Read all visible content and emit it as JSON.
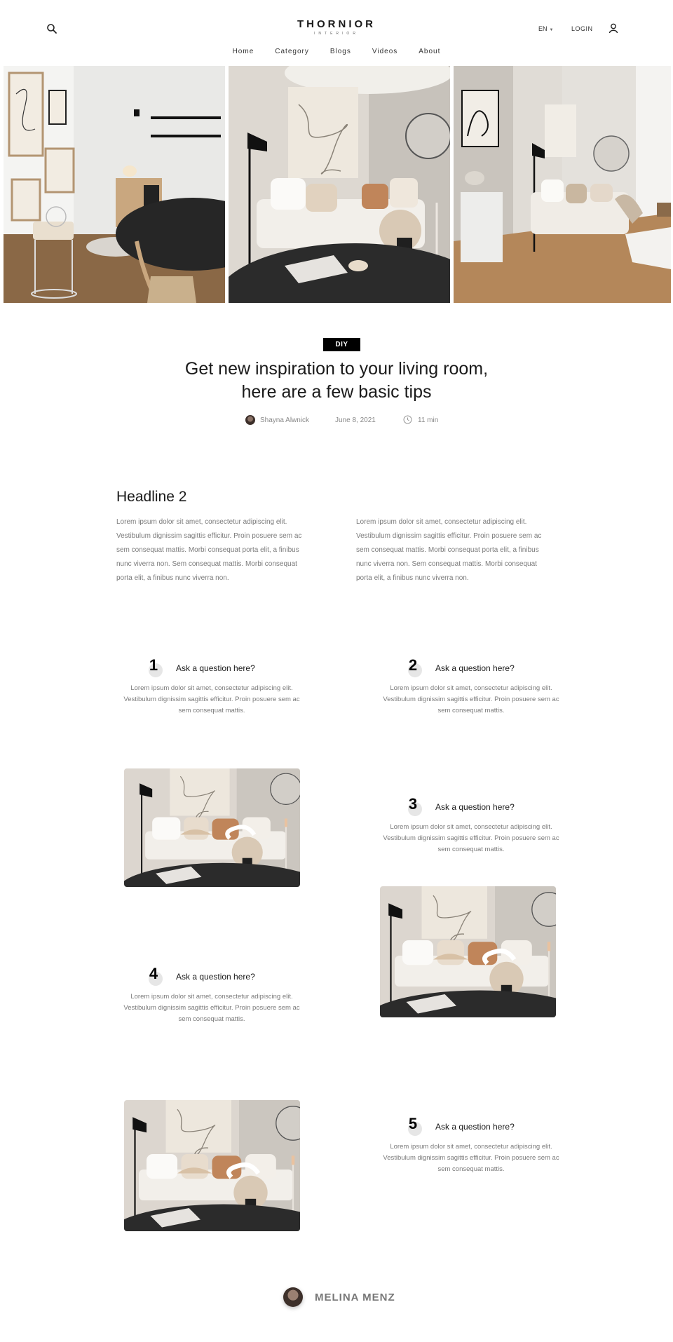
{
  "header": {
    "brand": "THORNIOR",
    "brand_sub": "INTERIOR",
    "language": "EN",
    "login": "LOGIN"
  },
  "nav": [
    "Home",
    "Category",
    "Blogs",
    "Videos",
    "About"
  ],
  "article": {
    "tag": "DIY",
    "title_line1": "Get new inspiration to your living room,",
    "title_line2": "here are a few basic tips",
    "author": "Shayna Alwnick",
    "date": "June 8, 2021",
    "read_time": "11 min"
  },
  "section": {
    "headline": "Headline 2",
    "paragraph_left": "Lorem ipsum dolor sit amet, consectetur adipiscing elit. Vestibulum dignissim sagittis efficitur. Proin posuere sem ac sem consequat mattis. Morbi consequat porta elit, a finibus nunc viverra non. Sem consequat mattis. Morbi consequat porta elit, a finibus nunc viverra non.",
    "paragraph_right": "Lorem ipsum dolor sit amet, consectetur adipiscing elit. Vestibulum dignissim sagittis efficitur. Proin posuere sem ac sem consequat mattis. Morbi consequat porta elit, a finibus nunc viverra non. Sem consequat mattis. Morbi consequat porta elit, a finibus nunc viverra non."
  },
  "questions": [
    {
      "number": "1",
      "title": "Ask a question here?",
      "text": "Lorem ipsum dolor sit amet, consectetur adipiscing elit. Vestibulum dignissim sagittis efficitur. Proin posuere sem ac sem consequat mattis."
    },
    {
      "number": "2",
      "title": "Ask a question here?",
      "text": "Lorem ipsum dolor sit amet, consectetur adipiscing elit. Vestibulum dignissim sagittis efficitur. Proin posuere sem ac sem consequat mattis."
    },
    {
      "number": "3",
      "title": "Ask a question here?",
      "text": "Lorem ipsum dolor sit amet, consectetur adipiscing elit. Vestibulum dignissim sagittis efficitur. Proin posuere sem ac sem consequat mattis."
    },
    {
      "number": "4",
      "title": "Ask a question here?",
      "text": "Lorem ipsum dolor sit amet, consectetur adipiscing elit. Vestibulum dignissim sagittis efficitur. Proin posuere sem ac sem consequat mattis."
    },
    {
      "number": "5",
      "title": "Ask a question here?",
      "text": "Lorem ipsum dolor sit amet, consectetur adipiscing elit. Vestibulum dignissim sagittis efficitur. Proin posuere sem ac sem consequat mattis."
    }
  ],
  "footer": {
    "author_name": "MELINA MENZ"
  },
  "icons": {
    "search": "search-icon",
    "user": "user-icon",
    "clock": "clock-icon",
    "caret": "chevron-down-icon"
  },
  "colors": {
    "text": "#1a1a1a",
    "muted": "#7a7a7a",
    "tag_bg": "#000000",
    "number_circle": "#e6e6e6"
  }
}
